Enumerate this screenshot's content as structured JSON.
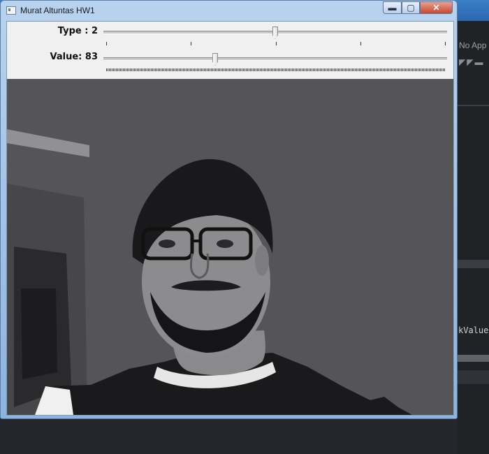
{
  "window": {
    "title": "Murat Altuntas HW1",
    "minimize_glyph": "▬",
    "maximize_glyph": "▢",
    "close_glyph": "✕"
  },
  "trackbars": [
    {
      "label": "Type : 2",
      "value": 2,
      "max": 4,
      "tick_count": 5
    },
    {
      "label": "Value: 83",
      "value": 83,
      "max": 255,
      "dense_ticks": true
    }
  ],
  "background_app": {
    "partial_text_top": "No App",
    "partial_code_text": "kValue"
  },
  "colors": {
    "title_bar": "#a9c8ea",
    "client_bg": "#f0f0f0",
    "image_bg": "#555558",
    "close_button": "#c7482f"
  },
  "image": {
    "description_icon": "webcam-grayscale-threshold-frame"
  }
}
